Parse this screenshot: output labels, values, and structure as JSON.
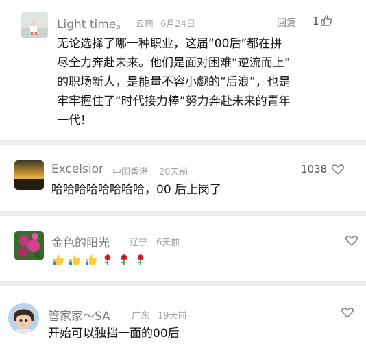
{
  "comments": [
    {
      "name": "Light time。",
      "location": "云南",
      "time": "6月24日",
      "reply": "回复",
      "likes": "1",
      "lines": [
        "无论选择了哪一种职业，这届“00后”都在拼",
        "尽全力奔赴未来。他们是面对困难“逆流而上”",
        "的职场新人，是能量不容小觑的“后浪”，也是",
        "牢牢握住了“时代接力棒”努力奔赴未来的青年",
        "一代！"
      ]
    },
    {
      "name": "Excelsior",
      "location": "中国香港",
      "time": "20天前",
      "likes": "1038",
      "text": "哈哈哈哈哈哈哈哈，00 后上岗了"
    },
    {
      "name": "金色的阳光",
      "location": "辽宁",
      "time": "6天前",
      "emojis": [
        "thumbs-up-icon",
        "thumbs-up-icon",
        "thumbs-up-icon",
        "rose-icon",
        "rose-icon",
        "rose-icon"
      ]
    },
    {
      "name": "管家家～SA",
      "location": "广东",
      "time": "19天前",
      "text": "开始可以独挡一面的00后"
    }
  ],
  "colors": {
    "separator": "#efefef",
    "name": "#7d7d7d",
    "meta": "#a6a6a6"
  }
}
